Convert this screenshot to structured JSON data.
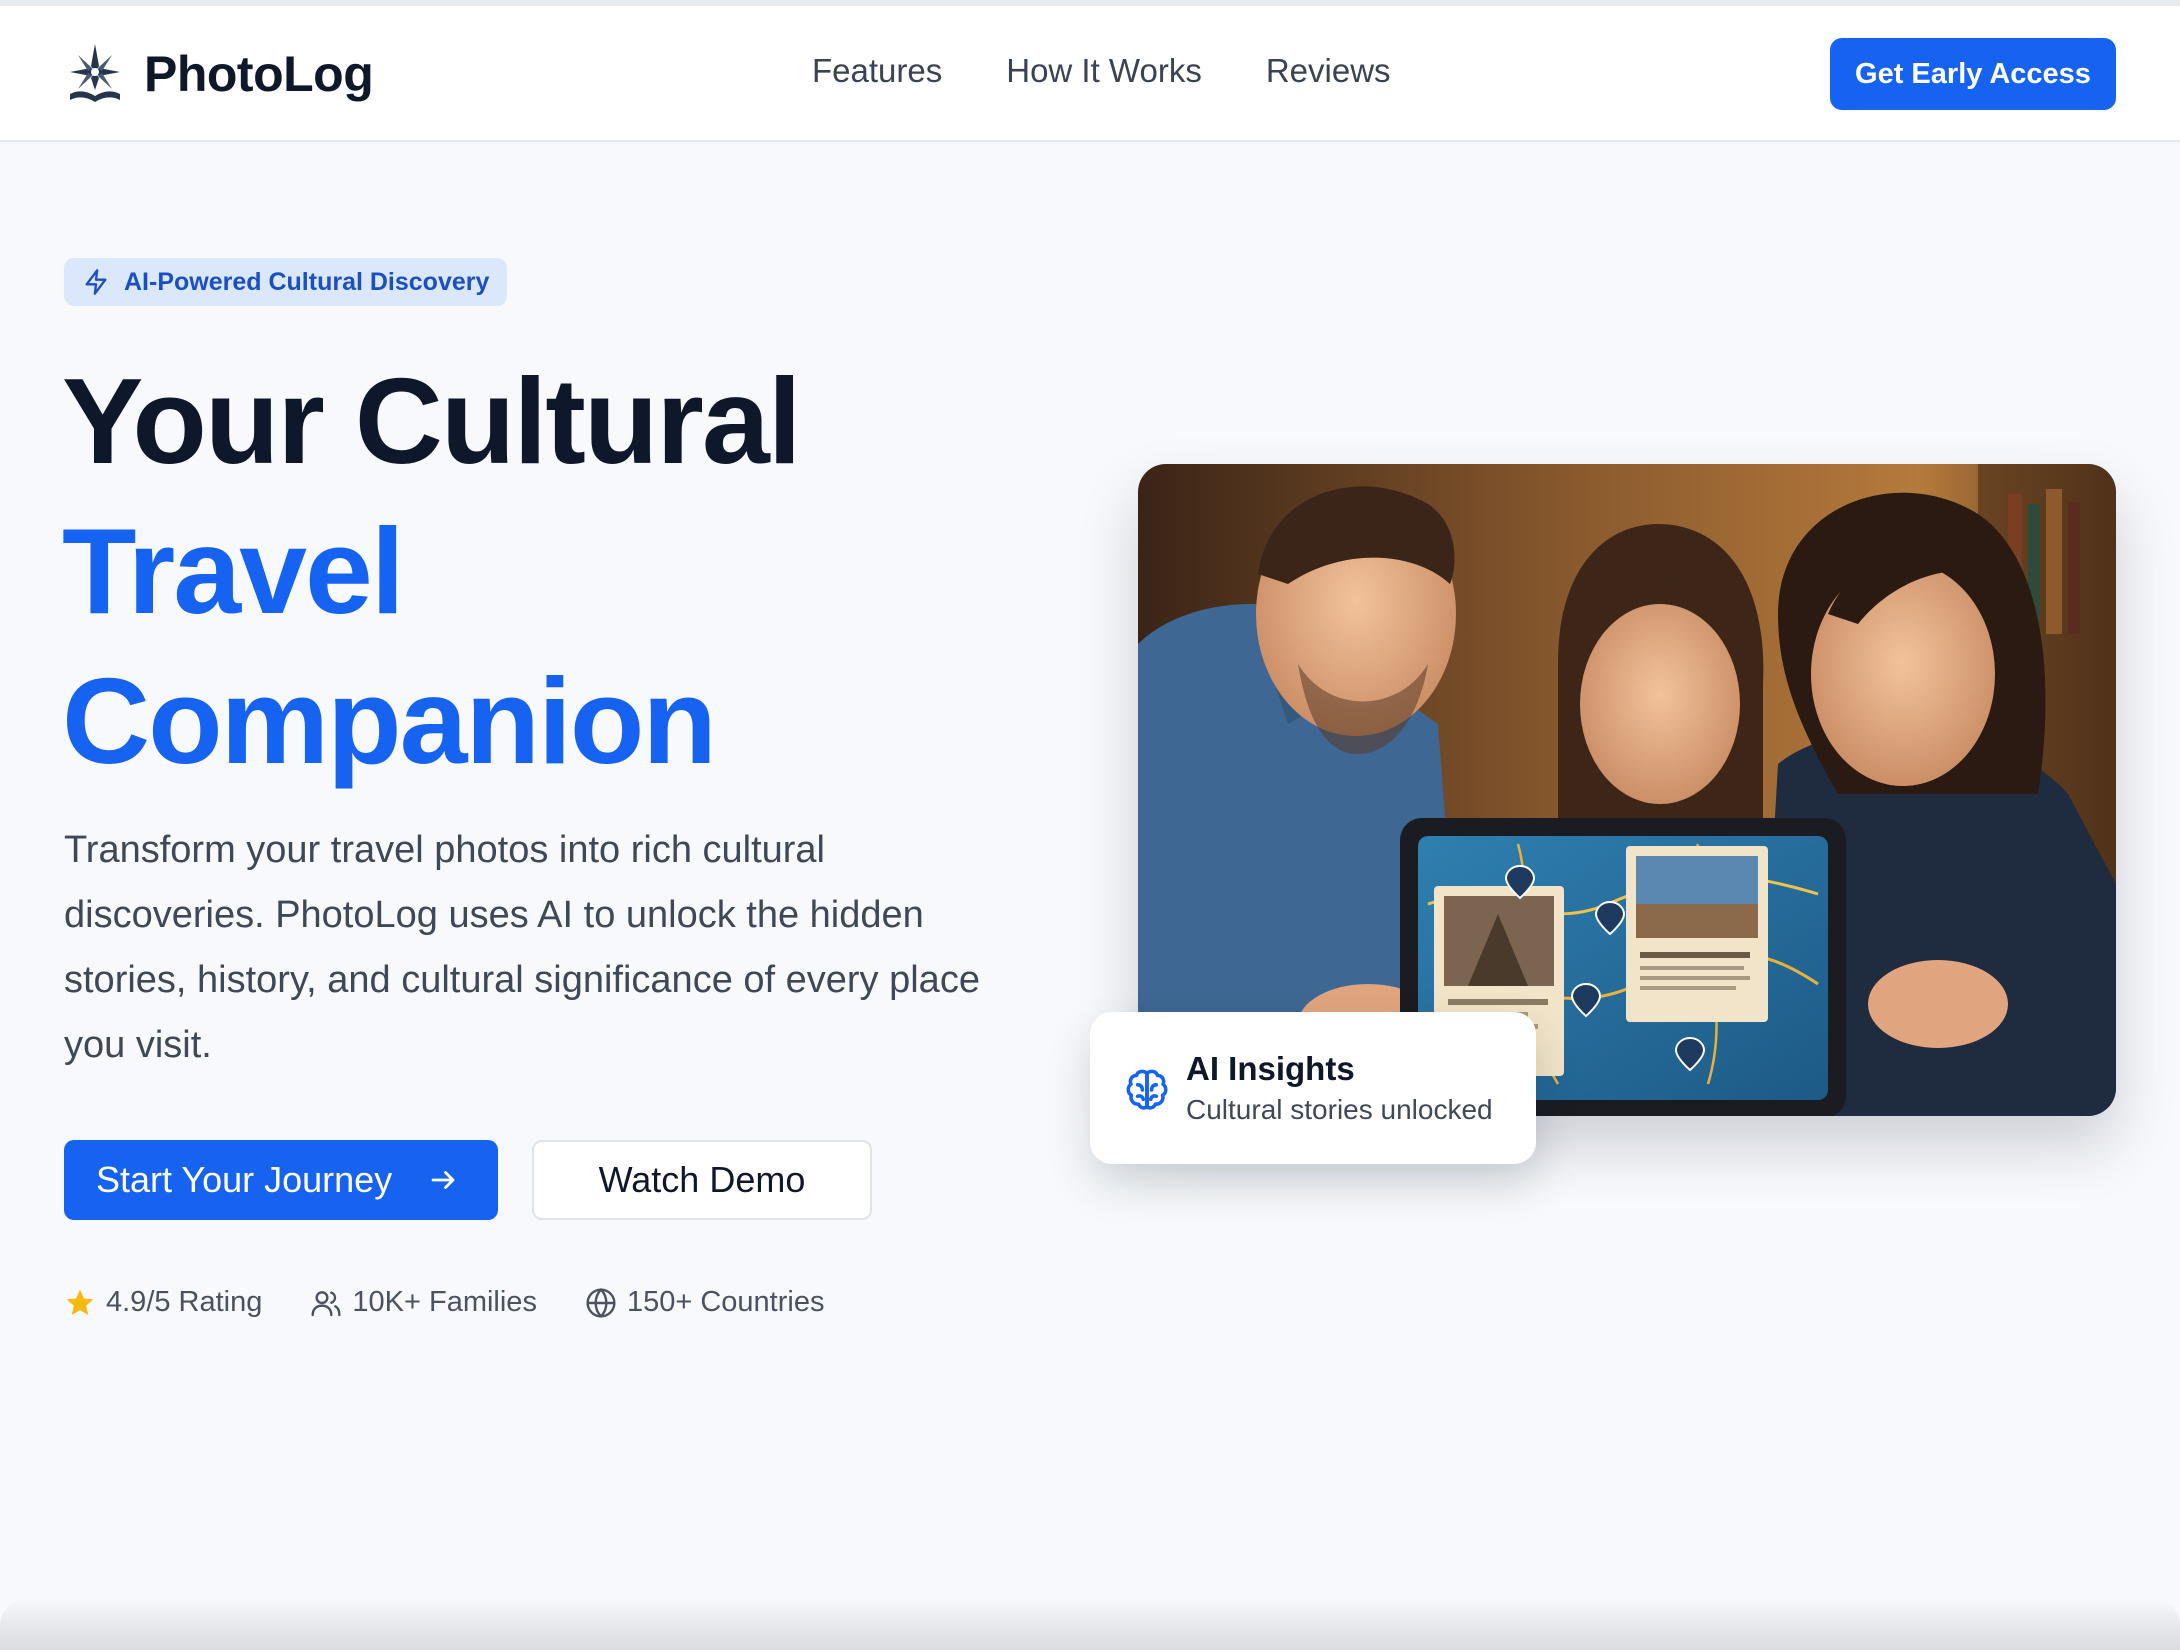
{
  "brand": {
    "name": "PhotoLog",
    "logo_icon": "compass-star-book-icon"
  },
  "nav": {
    "links": [
      "Features",
      "How It Works",
      "Reviews"
    ],
    "cta_label": "Get Early Access"
  },
  "hero": {
    "badge": {
      "icon": "lightning-icon",
      "text": "AI-Powered Cultural Discovery"
    },
    "headline": {
      "line1": "Your Cultural",
      "line2": "Travel",
      "line3": "Companion"
    },
    "description": "Transform your travel photos into rich cultural discoveries. PhotoLog uses AI to unlock the hidden stories, history, and cultural significance of every place you visit.",
    "primary_button": {
      "label": "Start Your Journey",
      "icon": "arrow-right-icon"
    },
    "secondary_button": {
      "label": "Watch Demo"
    },
    "stats": [
      {
        "icon": "star-icon",
        "text": "4.9/5 Rating"
      },
      {
        "icon": "users-icon",
        "text": "10K+ Families"
      },
      {
        "icon": "globe-icon",
        "text": "150+ Countries"
      }
    ],
    "insight_card": {
      "icon": "brain-icon",
      "title": "AI Insights",
      "subtitle": "Cultural stories unlocked"
    }
  },
  "colors": {
    "accent": "#1663f2",
    "headline_dark": "#0f172a",
    "badge_bg": "#dbe8fb",
    "star": "#f6b90b"
  }
}
